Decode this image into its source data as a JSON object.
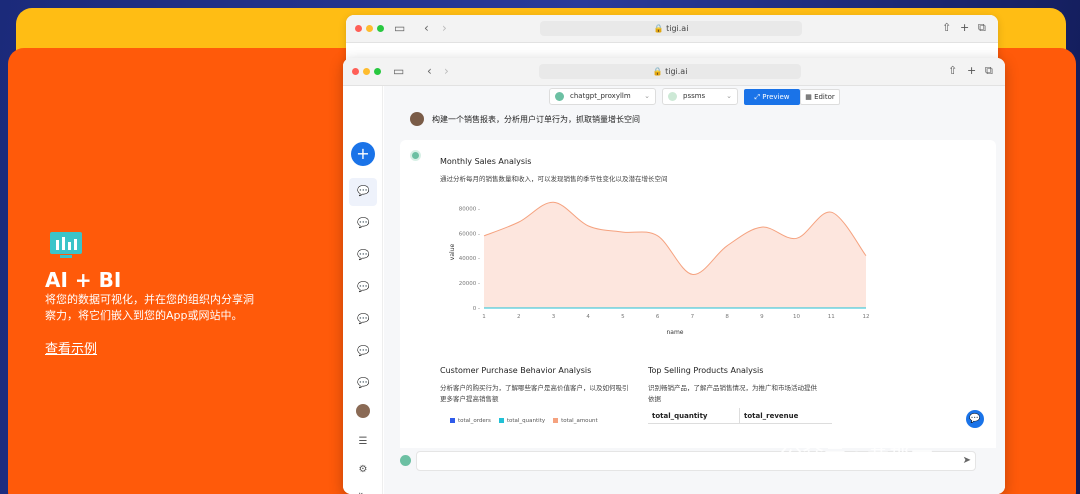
{
  "hero": {
    "title": "AI + BI",
    "description": "将您的数据可视化，并在您的组织内分享洞察力，将它们嵌入到您的App或网站中。",
    "link": "查看示例"
  },
  "browser": {
    "url": "tigi.ai"
  },
  "toolbar": {
    "model": "chatgpt_proxyllm",
    "db": "pssms",
    "preview": "Preview",
    "editor": "Editor"
  },
  "prompt": {
    "text": "构建一个销售报表，分析用户订单行为，抓取销量增长空间"
  },
  "report": {
    "monthly_title": "Monthly Sales Analysis",
    "monthly_desc": "通过分析每月的销售数量和收入，可以发现销售的季节性变化以及潜在增长空间",
    "customer_title": "Customer Purchase Behavior Analysis",
    "customer_desc": "分析客户的购买行为，了解哪些客户是高价值客户，以及如何吸引更多客户提高销售额",
    "legend": [
      "total_orders",
      "total_quantity",
      "total_amount"
    ],
    "top_title": "Top Selling Products Analysis",
    "top_desc": "识别畅销产品，了解产品销售情况，为推广和市场活动提供依据",
    "table_headers": [
      "total_quantity",
      "total_revenue"
    ]
  },
  "colors": {
    "accent": "#1a73e8",
    "orange": "#ff5a0a",
    "yellow": "#ffbd14",
    "area_fill": "#fde6de",
    "area_line": "#f5a27f"
  },
  "chart_data": {
    "type": "area",
    "x": [
      1,
      2,
      3,
      4,
      5,
      6,
      7,
      8,
      9,
      10,
      11,
      12
    ],
    "values": [
      58000,
      69000,
      85000,
      66000,
      61000,
      58000,
      27000,
      50000,
      65000,
      56000,
      77000,
      42000
    ],
    "xlabel": "name",
    "ylabel": "value",
    "ylim": [
      0,
      90000
    ],
    "yticks": [
      "0",
      "20000",
      "40000",
      "60000",
      "80000"
    ],
    "grid": false
  },
  "watermark": "公众号 · 赛那云"
}
